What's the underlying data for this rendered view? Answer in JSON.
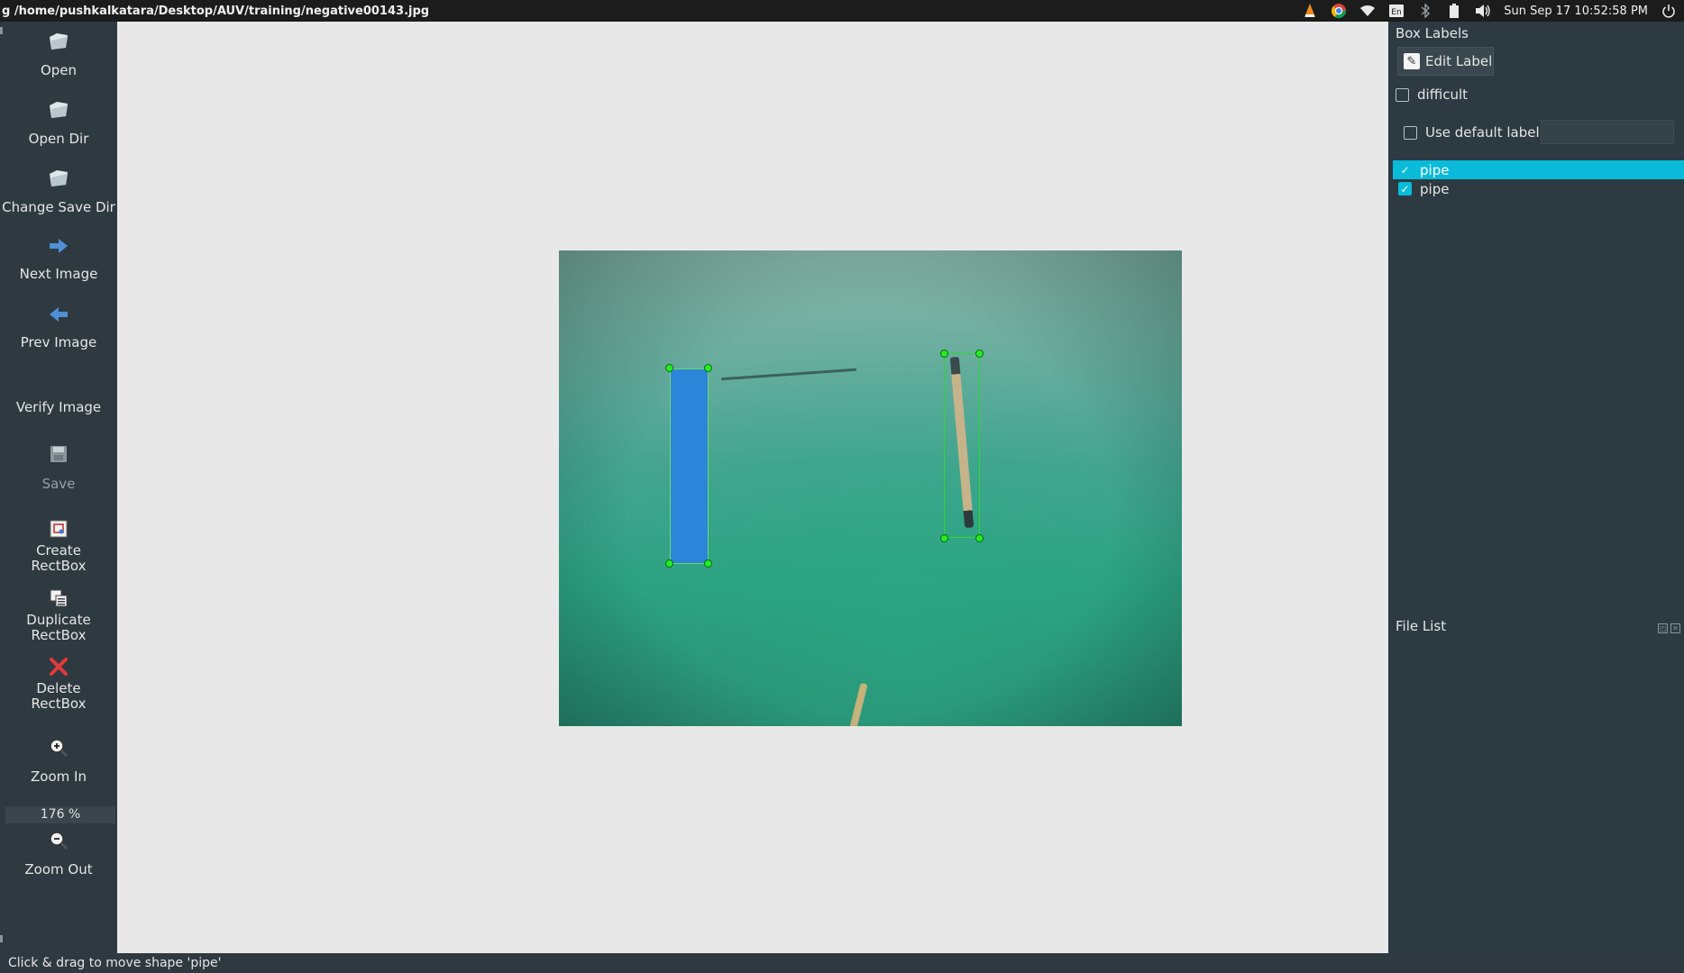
{
  "window": {
    "title": "g /home/pushkalkatara/Desktop/AUV/training/negative00143.jpg"
  },
  "system_tray": {
    "keyboard_layout": "En",
    "clock": "Sun Sep 17 10:52:58 PM",
    "icons": [
      "vlc-icon",
      "chrome-icon",
      "wifi-icon",
      "keyboard-icon",
      "bluetooth-icon",
      "battery-icon",
      "volume-icon",
      "power-icon"
    ]
  },
  "toolbar": {
    "open": "Open",
    "open_dir": "Open Dir",
    "change_save_dir": "Change Save Dir",
    "next_image": "Next Image",
    "prev_image": "Prev Image",
    "verify_image": "Verify Image",
    "save": "Save",
    "create_rectbox": "Create\nRectBox",
    "duplicate_rectbox": "Duplicate\nRectBox",
    "delete_rectbox": "Delete\nRectBox",
    "zoom_in": "Zoom In",
    "zoom_value": "176 %",
    "zoom_out": "Zoom Out"
  },
  "dock": {
    "box_labels_title": "Box Labels",
    "edit_label": "Edit Label",
    "difficult": "difficult",
    "difficult_checked": false,
    "use_default_label": "Use default label",
    "use_default_checked": false,
    "default_label_value": "",
    "labels": [
      {
        "text": "pipe",
        "checked": true,
        "selected": true
      },
      {
        "text": "pipe",
        "checked": true,
        "selected": false
      }
    ],
    "file_list_title": "File List"
  },
  "annotations": [
    {
      "label": "pipe",
      "selected": true
    },
    {
      "label": "pipe",
      "selected": false
    }
  ],
  "colors": {
    "selection_highlight": "#09bbd9",
    "box_outline": "#2dd92d",
    "selected_box_fill": "#2b86d9",
    "toolbar_bg": "#2f3a40"
  },
  "status_bar": {
    "message": "Click & drag to move shape 'pipe'"
  }
}
